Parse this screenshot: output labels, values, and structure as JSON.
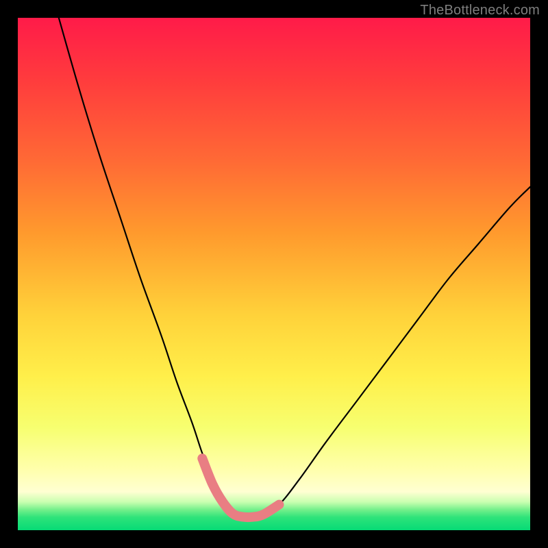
{
  "watermark": "TheBottleneck.com",
  "chart_data": {
    "type": "line",
    "title": "",
    "xlabel": "",
    "ylabel": "",
    "xlim": [
      0,
      100
    ],
    "ylim": [
      0,
      100
    ],
    "grid": false,
    "legend": null,
    "annotations": [],
    "series": [
      {
        "name": "bottleneck-curve",
        "color": "#000000",
        "x": [
          8,
          12,
          16,
          20,
          24,
          28,
          31,
          34,
          36,
          38,
          40,
          42,
          44,
          46,
          48,
          51,
          55,
          60,
          66,
          72,
          78,
          84,
          90,
          96,
          100
        ],
        "y": [
          100,
          86,
          73,
          61,
          49,
          38,
          29,
          21,
          15,
          10,
          6,
          3.5,
          2.7,
          2.7,
          3.2,
          5,
          10,
          17,
          25,
          33,
          41,
          49,
          56,
          63,
          67
        ]
      },
      {
        "name": "optimal-band",
        "color": "#e97e83",
        "x": [
          36,
          38,
          40,
          42,
          44,
          46,
          48,
          51
        ],
        "y": [
          14,
          9,
          5.5,
          3.2,
          2.6,
          2.6,
          3.1,
          5
        ]
      }
    ],
    "background_gradient": {
      "top": "#ff1b49",
      "mid": "#ffd23a",
      "bottom": "#06db76"
    }
  }
}
